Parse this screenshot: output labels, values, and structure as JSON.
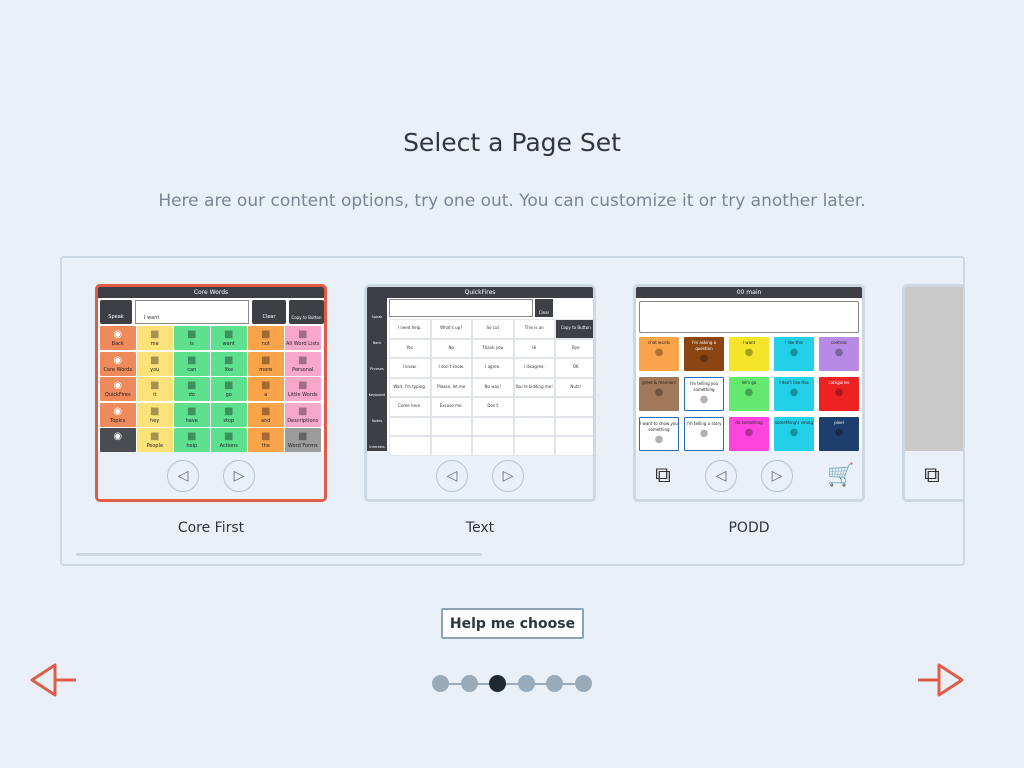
{
  "page": {
    "title": "Select a Page Set",
    "subtitle": "Here are our content options, try one out. You can customize it or try another later.",
    "help_button": "Help me choose"
  },
  "pagination": {
    "count": 6,
    "active_index": 2
  },
  "colors": {
    "accent": "#e05c48",
    "dot": "#9aaab9",
    "dot_active": "#1f2933",
    "border": "#cdd8e3"
  },
  "page_sets": [
    {
      "label": "Core First",
      "selected": true,
      "screen_title": "Core Words",
      "toolbar": {
        "speak": "Speak",
        "clear": "Clear",
        "copy": "Copy to Button"
      },
      "message": "I want",
      "grid": [
        [
          {
            "t": "Back",
            "c": "#ef8a5c"
          },
          {
            "t": "me",
            "c": "#fde27a"
          },
          {
            "t": "is",
            "c": "#5ee08e"
          },
          {
            "t": "want",
            "c": "#5ee08e"
          },
          {
            "t": "not",
            "c": "#f9a34a"
          },
          {
            "t": "All Word Lists",
            "c": "#f7a8c8"
          }
        ],
        [
          {
            "t": "Core Words",
            "c": "#ef8a5c"
          },
          {
            "t": "you",
            "c": "#fde27a"
          },
          {
            "t": "can",
            "c": "#5ee08e"
          },
          {
            "t": "like",
            "c": "#5ee08e"
          },
          {
            "t": "more",
            "c": "#f9a34a"
          },
          {
            "t": "Personal",
            "c": "#f7a8c8"
          }
        ],
        [
          {
            "t": "QuickFires",
            "c": "#ef8a5c"
          },
          {
            "t": "it",
            "c": "#fde27a"
          },
          {
            "t": "do",
            "c": "#5ee08e"
          },
          {
            "t": "go",
            "c": "#5ee08e"
          },
          {
            "t": "a",
            "c": "#f9a34a"
          },
          {
            "t": "Little Words",
            "c": "#f7a8c8"
          }
        ],
        [
          {
            "t": "Topics",
            "c": "#ef8a5c"
          },
          {
            "t": "hey",
            "c": "#fde27a"
          },
          {
            "t": "have",
            "c": "#5ee08e"
          },
          {
            "t": "stop",
            "c": "#5ee08e"
          },
          {
            "t": "and",
            "c": "#f9a34a"
          },
          {
            "t": "Descriptions",
            "c": "#f7a8c8"
          }
        ],
        [
          {
            "t": "",
            "c": "#4a4c51"
          },
          {
            "t": "People",
            "c": "#fde27a"
          },
          {
            "t": "help",
            "c": "#5ee08e"
          },
          {
            "t": "Actions",
            "c": "#5ee08e"
          },
          {
            "t": "the",
            "c": "#f9a34a"
          },
          {
            "t": "Word Forms",
            "c": "#9c9c9c"
          }
        ]
      ]
    },
    {
      "label": "Text",
      "selected": false,
      "screen_title": "QuickFires",
      "sidebar": [
        "Speak",
        "Back",
        "Phrases",
        "Keyboard",
        "Notes",
        "Interests"
      ],
      "toolbar": {
        "clear": "Clear",
        "copy": "Copy to Button"
      },
      "phrases": [
        [
          "I need help.",
          "What's up?",
          "So cut",
          "This is an emergency.",
          "Copy to Button"
        ],
        [
          "Yes",
          "No",
          "Thank you",
          "Hi",
          "Bye"
        ],
        [
          "I know.",
          "I don't know.",
          "I agree.",
          "I disagree.",
          "OK"
        ],
        [
          "Wait, I'm typing.",
          "Please, let me finish.",
          "No way!",
          "You're kidding me!",
          "Nuts!"
        ],
        [
          "Come here.",
          "Excuse me.",
          "Don't",
          "",
          ""
        ]
      ]
    },
    {
      "label": "PODD",
      "selected": false,
      "screen_title": "00 main",
      "folders": [
        [
          {
            "t": "chat words",
            "c": "#f9a34a"
          },
          {
            "t": "I'm asking a question",
            "c": "#8b4513"
          },
          {
            "t": "I want",
            "c": "#f5e52a"
          },
          {
            "t": "I like this",
            "c": "#22d0e8"
          },
          {
            "t": "controls",
            "c": "#b78ae6"
          }
        ],
        [
          {
            "t": "greet & manners",
            "c": "#a0785a"
          },
          {
            "t": "I'm telling you something",
            "c": "#ffffff"
          },
          {
            "t": "let's go",
            "c": "#64e870"
          },
          {
            "t": "I don't like this",
            "c": "#22d0e8"
          },
          {
            "t": "categories",
            "c": "#ee2222"
          }
        ],
        [
          {
            "t": "I want to show you something",
            "c": "#ffffff"
          },
          {
            "t": "I'm telling a story",
            "c": "#ffffff"
          },
          {
            "t": "do something",
            "c": "#ff44dd"
          },
          {
            "t": "something's wrong",
            "c": "#22d0e8"
          },
          {
            "t": "pixel",
            "c": "#1e3f6e"
          }
        ]
      ]
    },
    {
      "label": "",
      "selected": false
    }
  ]
}
